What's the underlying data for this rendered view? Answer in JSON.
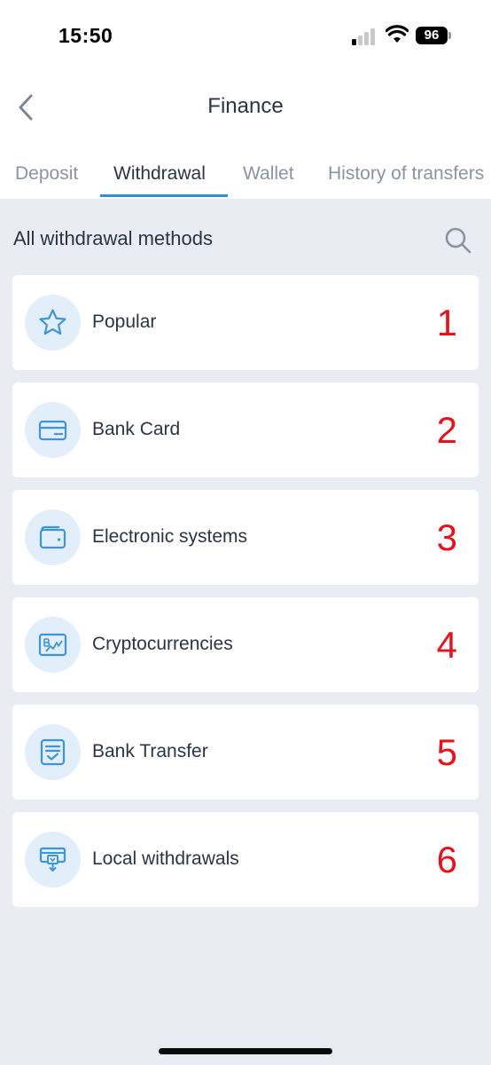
{
  "status_bar": {
    "time": "15:50",
    "battery": "96"
  },
  "nav": {
    "title": "Finance"
  },
  "tabs": [
    {
      "label": "Deposit",
      "active": false
    },
    {
      "label": "Withdrawal",
      "active": true
    },
    {
      "label": "Wallet",
      "active": false
    },
    {
      "label": "History of transfers",
      "active": false
    }
  ],
  "section": {
    "title": "All withdrawal methods"
  },
  "methods": [
    {
      "label": "Popular",
      "number": "1",
      "icon": "star-icon"
    },
    {
      "label": "Bank Card",
      "number": "2",
      "icon": "bank-card-icon"
    },
    {
      "label": "Electronic systems",
      "number": "3",
      "icon": "wallet-icon"
    },
    {
      "label": "Cryptocurrencies",
      "number": "4",
      "icon": "crypto-icon"
    },
    {
      "label": "Bank Transfer",
      "number": "5",
      "icon": "document-check-icon"
    },
    {
      "label": "Local withdrawals",
      "number": "6",
      "icon": "local-withdrawal-icon"
    }
  ],
  "colors": {
    "accent": "#2e8fd6",
    "annotation": "#e4141d",
    "background": "#e9edf3"
  }
}
